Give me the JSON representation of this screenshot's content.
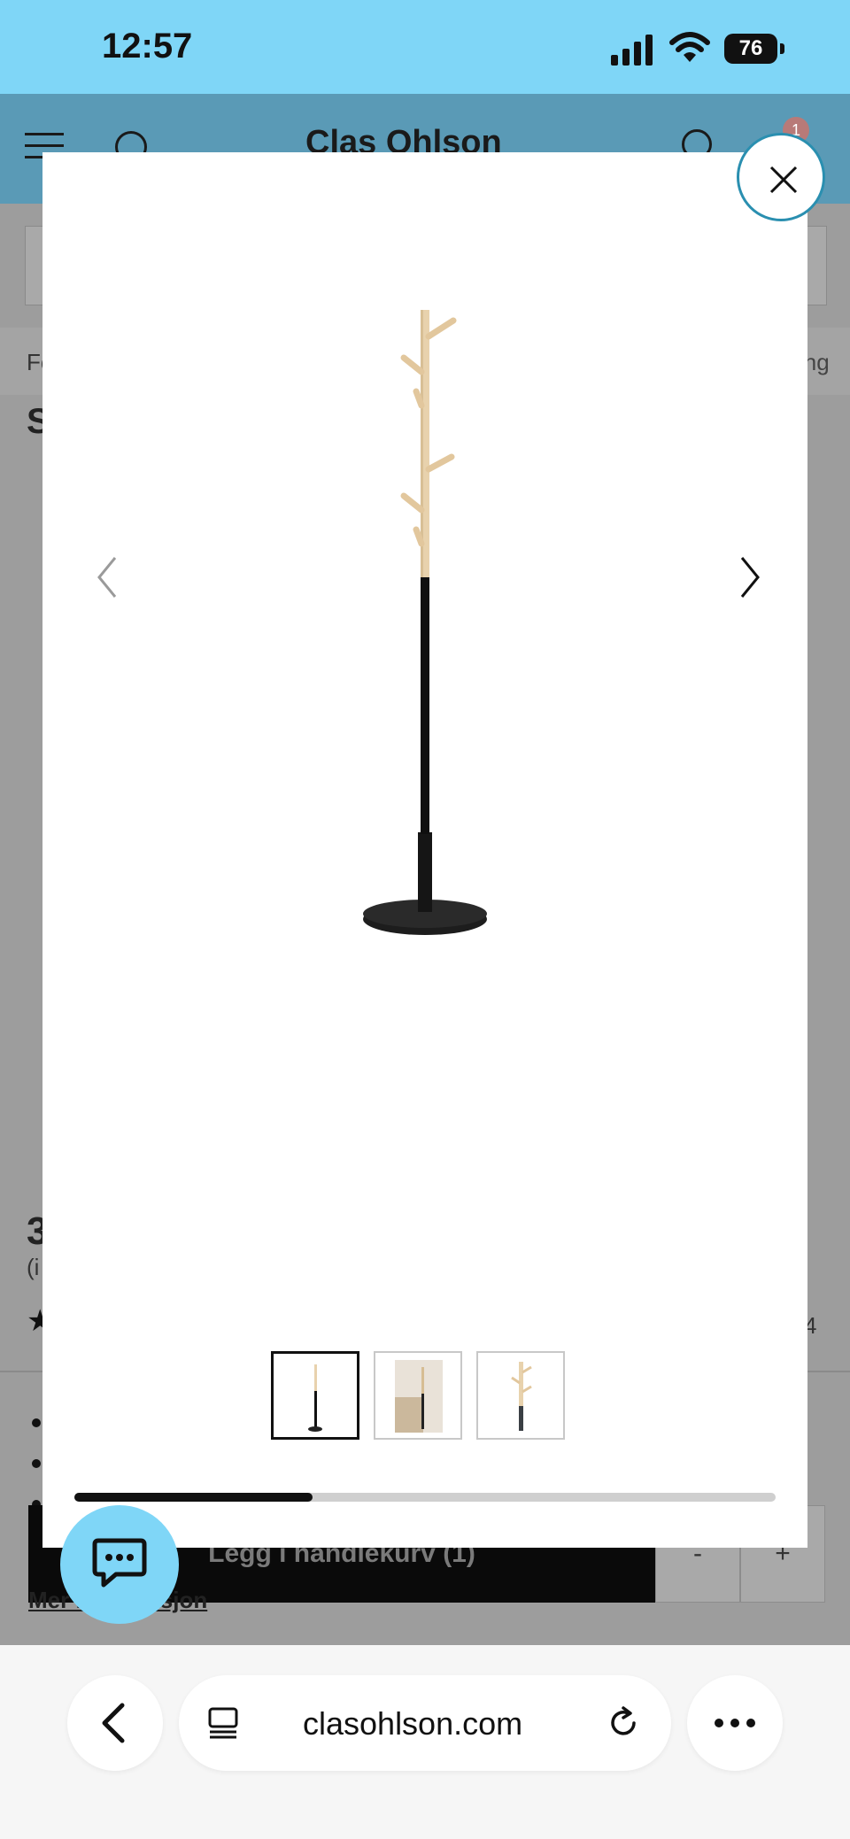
{
  "status_bar": {
    "time": "12:57",
    "battery": "76"
  },
  "header": {
    "logo_text": "Clas Ohlson",
    "cart_count": "1"
  },
  "background_page": {
    "breadcrumb_start": "Fo",
    "breadcrumb_end": "ing",
    "title_fragment": "S",
    "price_fragment": "3",
    "price_sub_fragment": "(i",
    "rating_fragment": "4",
    "add_to_cart_label": "Legg i handlekurv (1)",
    "qty_minus": "-",
    "qty_plus": "+",
    "more_link": "Mer informasjon"
  },
  "gallery": {
    "progress": 0.34,
    "active_index": 0,
    "thumbnails": [
      "coat-stand-front",
      "coat-stand-room",
      "coat-stand-top"
    ]
  },
  "browser": {
    "url": "clasohlson.com"
  },
  "colors": {
    "status_bar": "#7fd6f7",
    "header": "#5a9ab6",
    "close_ring": "#2a8fb0",
    "wood": "#e8d2ad",
    "pole": "#111111"
  }
}
